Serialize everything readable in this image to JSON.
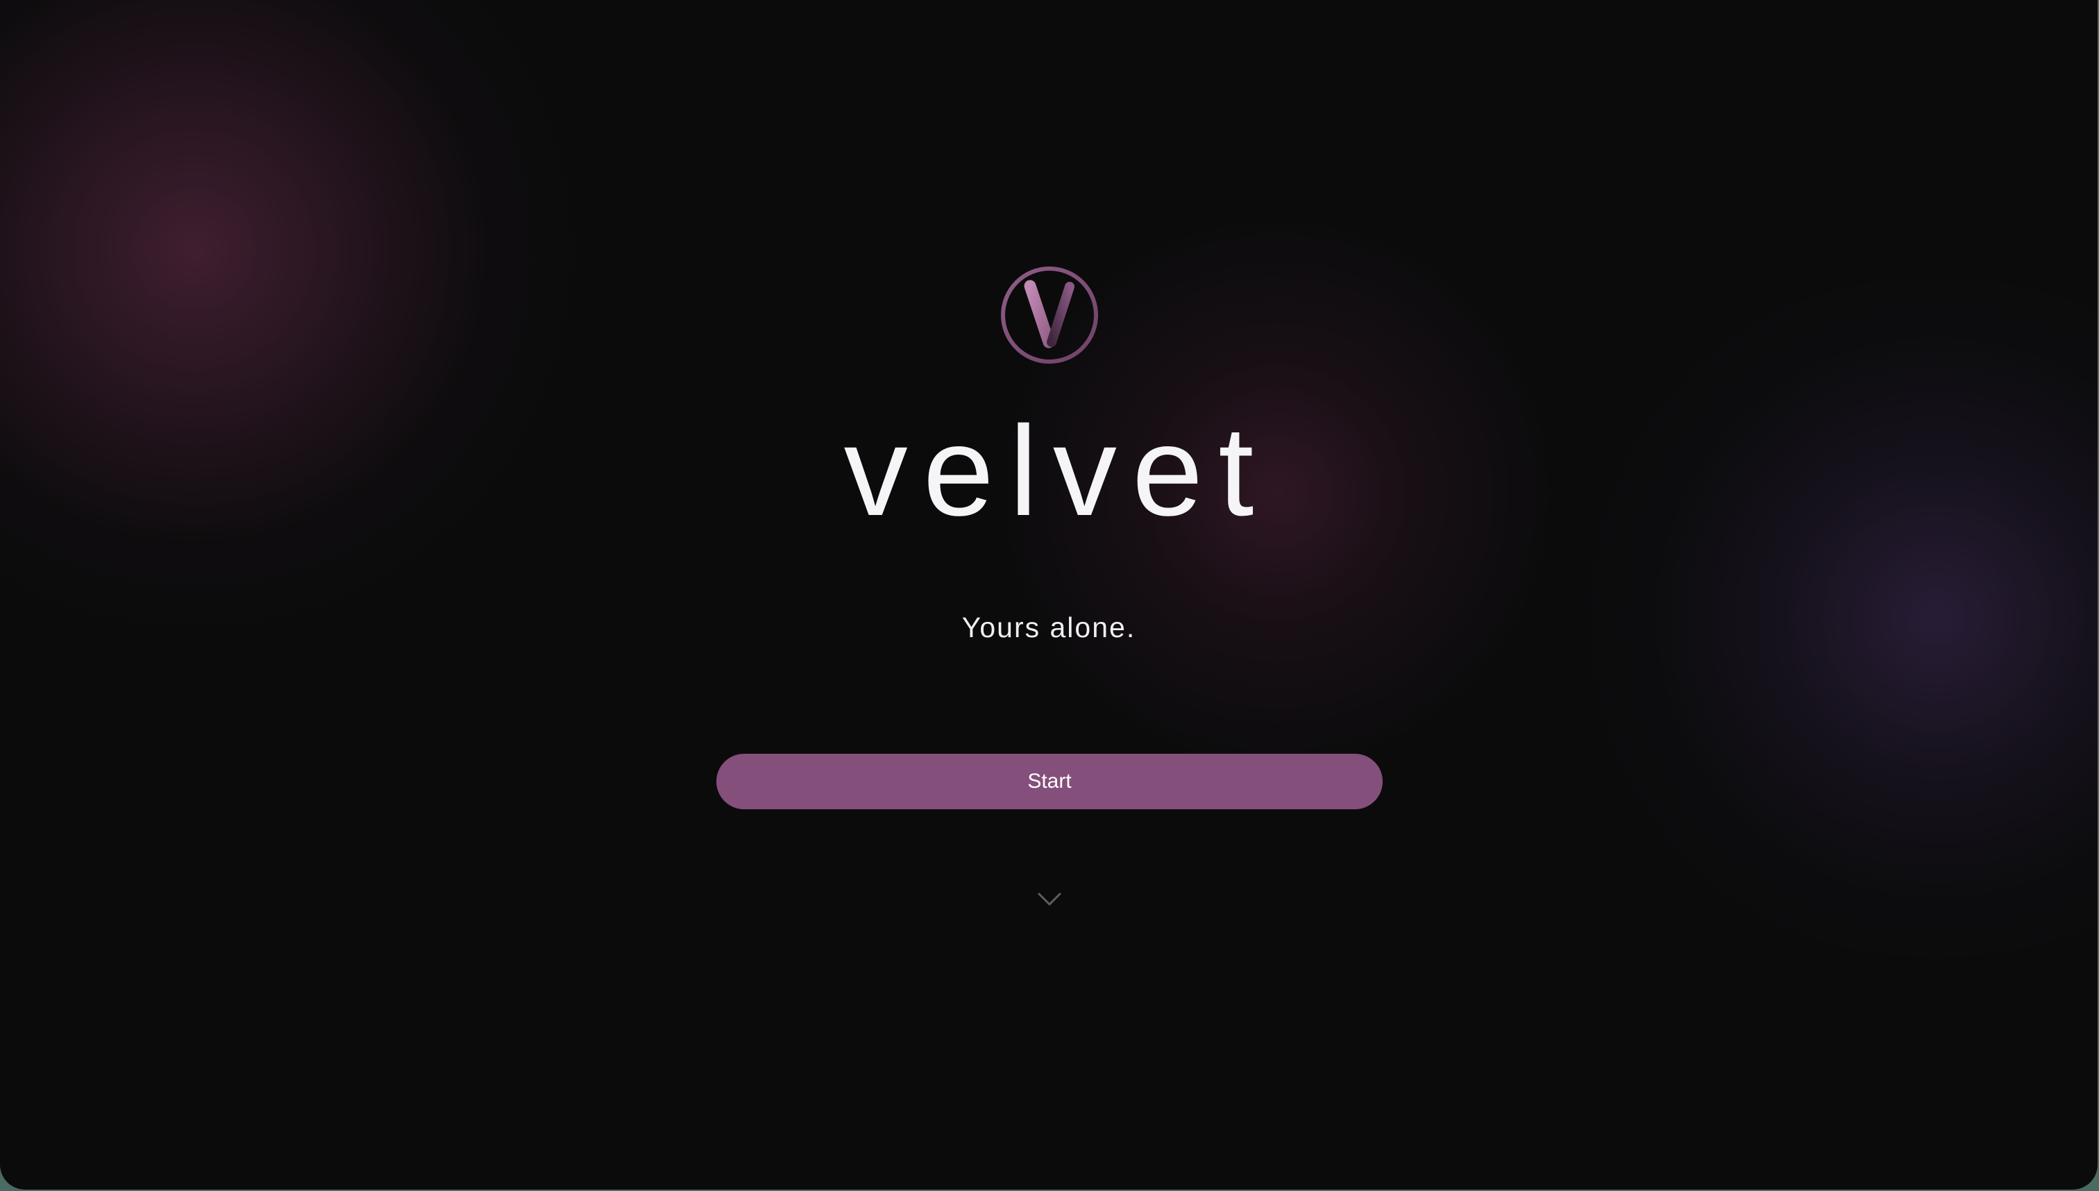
{
  "app": {
    "logo_icon": "velvet-v-logo-icon",
    "name": "velvet",
    "tagline": "Yours alone."
  },
  "actions": {
    "start_label": "Start",
    "scroll_icon": "chevron-down-icon"
  },
  "colors": {
    "background": "#0b0b0c",
    "accent": "#844f7b",
    "text": "#f5f5f7",
    "logo_ring": "#7d4e77",
    "logo_mark_light": "#a66c9b",
    "logo_mark_dark": "#4c2f49"
  }
}
